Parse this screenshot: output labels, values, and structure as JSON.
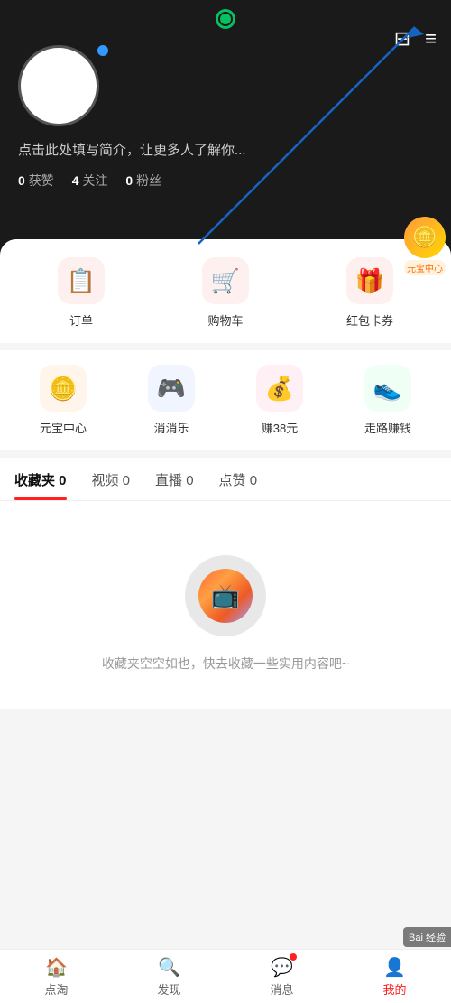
{
  "app": {
    "title": "我的",
    "status_icon": "●"
  },
  "header": {
    "top_right_icon1": "⊟",
    "top_right_icon2": "≡",
    "bio_placeholder": "点击此处填写简介，让更多人了解你...",
    "stats": {
      "likes": "0",
      "likes_label": "获赞",
      "following": "4",
      "following_label": "关注",
      "fans": "0",
      "fans_label": "粉丝"
    }
  },
  "yuanbao": {
    "icon": "🪙",
    "label": "元宝中心"
  },
  "quick_actions": {
    "row1": [
      {
        "label": "订单",
        "icon": "📋",
        "class": "order"
      },
      {
        "label": "购物车",
        "icon": "🛒",
        "class": "cart"
      },
      {
        "label": "红包卡券",
        "icon": "🎁",
        "class": "coupon"
      }
    ],
    "row2": [
      {
        "label": "元宝中心",
        "icon": "🪙",
        "class": "yuanbao"
      },
      {
        "label": "消消乐",
        "icon": "🎮",
        "class": "game"
      },
      {
        "label": "赚38元",
        "icon": "💰",
        "class": "earn38"
      },
      {
        "label": "走路赚钱",
        "icon": "👟",
        "class": "walk"
      }
    ]
  },
  "tabs": [
    {
      "label": "收藏夹 0",
      "active": true
    },
    {
      "label": "视频 0",
      "active": false
    },
    {
      "label": "直播 0",
      "active": false
    },
    {
      "label": "点赞 0",
      "active": false
    }
  ],
  "empty_state": {
    "text": "收藏夹空空如也，快去收藏一些实用内容吧~"
  },
  "bottom_nav": [
    {
      "label": "点淘",
      "icon": "🏠",
      "active": false,
      "badge": false
    },
    {
      "label": "发现",
      "icon": "🔍",
      "active": false,
      "badge": false
    },
    {
      "label": "消息",
      "icon": "💬",
      "active": false,
      "badge": true
    },
    {
      "label": "我的",
      "icon": "👤",
      "active": true,
      "badge": false
    }
  ],
  "baidu": {
    "text": "Bai 经验"
  }
}
